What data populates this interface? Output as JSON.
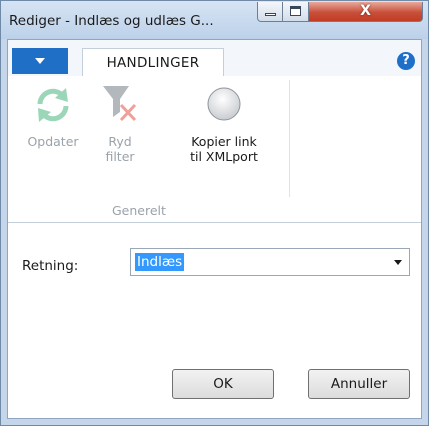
{
  "window": {
    "title": "Rediger - Indlæs og udlæs G...",
    "close_glyph": "X"
  },
  "ribbon": {
    "tab_label": "HANDLINGER",
    "help_glyph": "?",
    "actions": [
      {
        "label_line1": "Opdater",
        "label_line2": "",
        "enabled": false,
        "icon": "refresh-icon"
      },
      {
        "label_line1": "Ryd",
        "label_line2": "filter",
        "enabled": false,
        "icon": "clear-filter-icon"
      },
      {
        "label_line1": "Kopier link",
        "label_line2": "til XMLport",
        "enabled": true,
        "icon": "copy-link-icon"
      }
    ],
    "group_label": "Generelt"
  },
  "form": {
    "direction_label": "Retning:",
    "direction_value": "Indlæs"
  },
  "buttons": {
    "ok": "OK",
    "cancel": "Annuller"
  },
  "colors": {
    "accent": "#1f6fc6",
    "selection": "#3399ff",
    "close_button": "#c7503a",
    "disabled_text": "#9aa2aa"
  }
}
